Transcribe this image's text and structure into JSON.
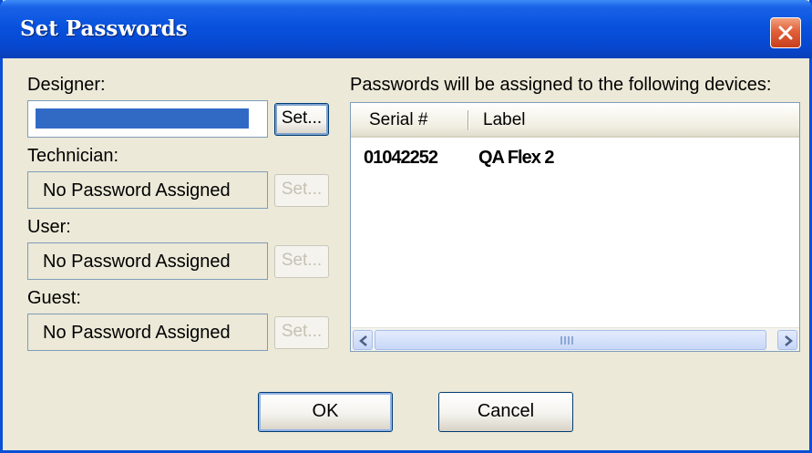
{
  "window": {
    "title": "Set Passwords"
  },
  "roles": [
    {
      "label": "Designer:",
      "value": "",
      "set_label": "Set...",
      "enabled": true
    },
    {
      "label": "Technician:",
      "value": "No Password Assigned",
      "set_label": "Set...",
      "enabled": false
    },
    {
      "label": "User:",
      "value": "No Password Assigned",
      "set_label": "Set...",
      "enabled": false
    },
    {
      "label": "Guest:",
      "value": "No Password Assigned",
      "set_label": "Set...",
      "enabled": false
    }
  ],
  "devices": {
    "caption": "Passwords will be assigned to the following devices:",
    "columns": [
      "Serial #",
      "Label"
    ],
    "rows": [
      {
        "serial": "01042252",
        "label": "QA Flex 2"
      }
    ]
  },
  "buttons": {
    "ok": "OK",
    "cancel": "Cancel"
  },
  "icons": {
    "close": "close-icon",
    "scroll_left": "arrow-left-icon",
    "scroll_right": "arrow-right-icon"
  },
  "colors": {
    "titlebar": "#0852dd",
    "dialog_bg": "#ece9d8",
    "selection": "#316ac5",
    "close_button": "#e0603a"
  }
}
